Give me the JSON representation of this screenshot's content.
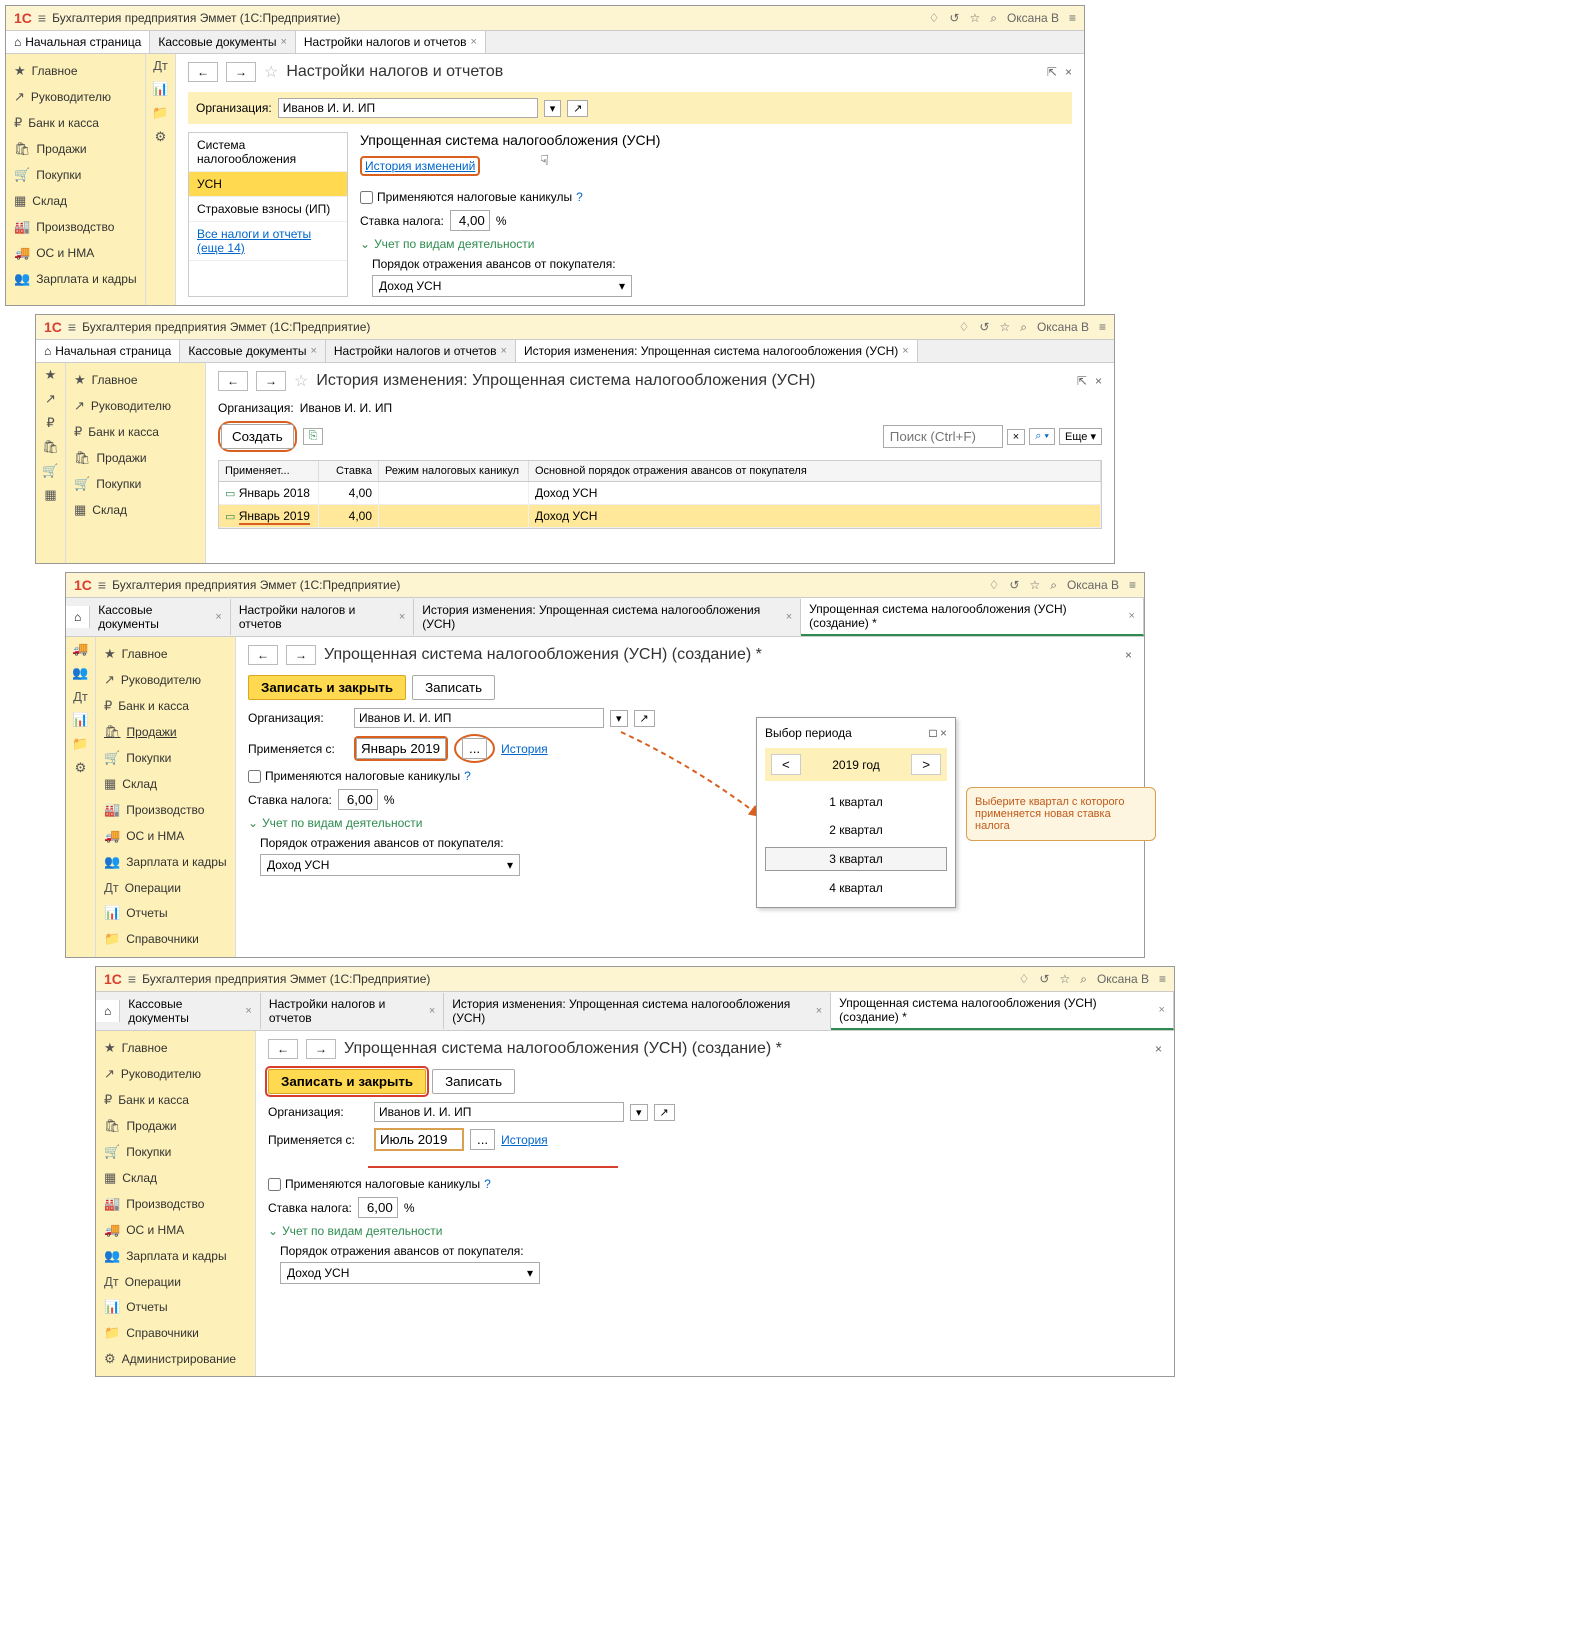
{
  "app_title": "Бухгалтерия предприятия Эммет  (1С:Предприятие)",
  "user": "Оксана В",
  "home_tab": "Начальная страница",
  "tabs": {
    "cash": "Кассовые документы",
    "settings": "Настройки налогов и отчетов",
    "history": "История изменения: Упрощенная система налогообложения (УСН)",
    "create": "Упрощенная система налогообложения (УСН) (создание) *"
  },
  "sidebar": {
    "main": "Главное",
    "manager": "Руководителю",
    "bank": "Банк и касса",
    "sales": "Продажи",
    "purchases": "Покупки",
    "warehouse": "Склад",
    "production": "Производство",
    "os": "ОС и НМА",
    "salary": "Зарплата и кадры",
    "operations": "Операции",
    "reports": "Отчеты",
    "refs": "Справочники",
    "admin": "Администрирование"
  },
  "page1": {
    "title": "Настройки налогов и отчетов",
    "org_label": "Организация:",
    "org_value": "Иванов И. И. ИП",
    "nav": {
      "system": "Система налогообложения",
      "usn": "УСН",
      "insurance": "Страховые взносы (ИП)",
      "all": "Все налоги и отчеты (еще 14)"
    },
    "section_title": "Упрощенная система налогообложения (УСН)",
    "history_link": "История изменений",
    "holidays": "Применяются налоговые каникулы",
    "rate_label": "Ставка налога:",
    "rate_value": "4,00",
    "percent": "%",
    "activity": "Учет по видам деятельности",
    "advance_order": "Порядок отражения авансов от покупателя:",
    "income": "Доход УСН"
  },
  "page2": {
    "title": "История изменения: Упрощенная система налогообложения (УСН)",
    "org_label": "Организация:",
    "org_value": "Иванов И. И. ИП",
    "create_btn": "Создать",
    "search_placeholder": "Поиск (Ctrl+F)",
    "more": "Еще",
    "cols": {
      "applies": "Применяет...",
      "rate": "Ставка",
      "mode": "Режим налоговых каникул",
      "order": "Основной порядок отражения авансов от покупателя"
    },
    "rows": [
      {
        "date": "Январь 2018",
        "rate": "4,00",
        "order": "Доход УСН"
      },
      {
        "date": "Январь 2019",
        "rate": "4,00",
        "order": "Доход УСН"
      }
    ]
  },
  "page3": {
    "title": "Упрощенная система налогообложения (УСН) (создание) *",
    "write_close": "Записать и закрыть",
    "write": "Записать",
    "org_label": "Организация:",
    "org_value": "Иванов И. И. ИП",
    "applies_label": "Применяется с:",
    "applies_value": "Январь 2019",
    "history": "История",
    "holidays": "Применяются налоговые каникулы",
    "rate_label": "Ставка налога:",
    "rate_value": "6,00",
    "percent": "%",
    "activity": "Учет по видам деятельности",
    "advance_order": "Порядок отражения авансов от покупателя:",
    "income": "Доход УСН",
    "period_dialog": {
      "title": "Выбор периода",
      "year": "2019 год",
      "q1": "1 квартал",
      "q2": "2 квартал",
      "q3": "3 квартал",
      "q4": "4 квартал"
    },
    "callout": "Выберите квартал с которого применяется новая ставка налога"
  },
  "page4": {
    "title": "Упрощенная система налогообложения (УСН) (создание) *",
    "write_close": "Записать и закрыть",
    "write": "Записать",
    "org_label": "Организация:",
    "org_value": "Иванов И. И. ИП",
    "applies_label": "Применяется с:",
    "applies_value": "Июль 2019",
    "history": "История",
    "holidays": "Применяются налоговые каникулы",
    "rate_label": "Ставка налога:",
    "rate_value": "6,00",
    "percent": "%",
    "activity": "Учет по видам деятельности",
    "advance_order": "Порядок отражения авансов от покупателя:",
    "income": "Доход УСН"
  }
}
